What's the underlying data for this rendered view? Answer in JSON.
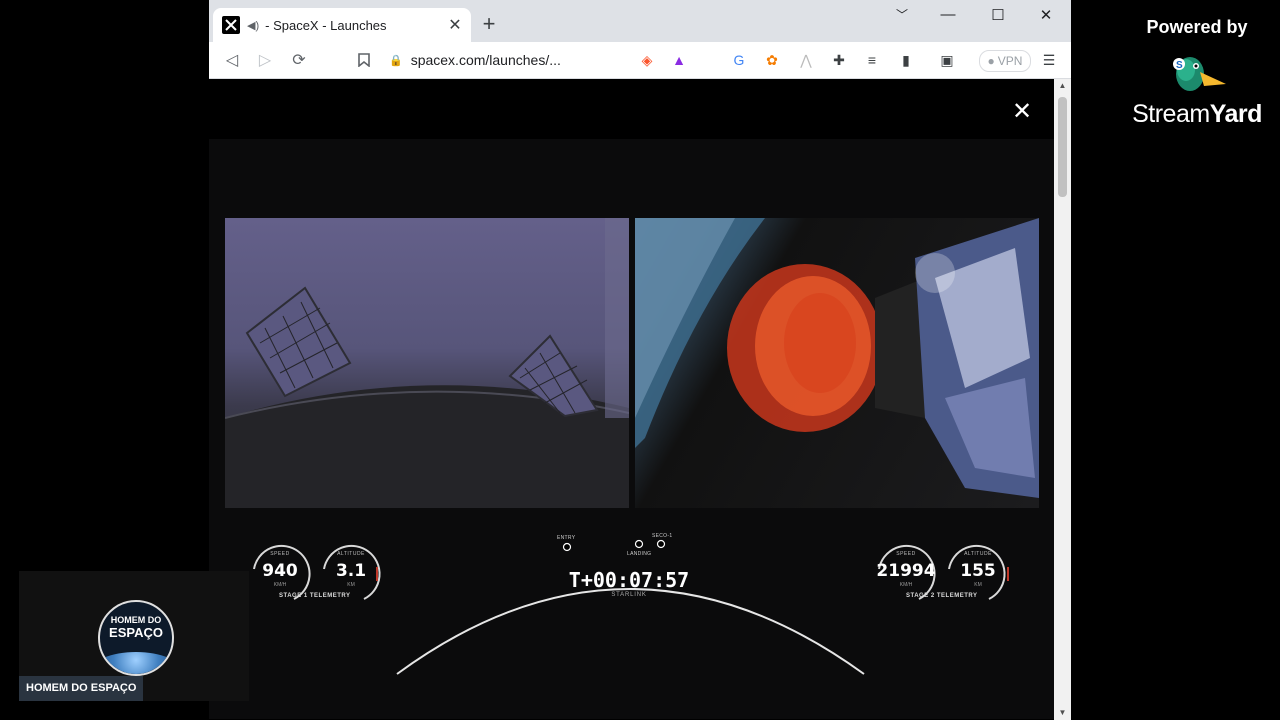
{
  "browser": {
    "tab_title": "- SpaceX - Launches",
    "url": "spacex.com/launches/...",
    "vpn_label": "VPN"
  },
  "telemetry": {
    "stage1": {
      "label": "STAGE 1 TELEMETRY",
      "speed": {
        "label": "SPEED",
        "value": "940",
        "unit": "KM/H"
      },
      "altitude": {
        "label": "ALTITUDE",
        "value": "3.1",
        "unit": "KM"
      }
    },
    "stage2": {
      "label": "STAGE 2 TELEMETRY",
      "speed": {
        "label": "SPEED",
        "value": "21994",
        "unit": "KM/H"
      },
      "altitude": {
        "label": "ALTITUDE",
        "value": "155",
        "unit": "KM"
      }
    },
    "clock": "T+00:07:57",
    "mission": "STARLINK",
    "events": {
      "entry": "ENTRY",
      "landing": "LANDING",
      "seco": "SECO-1"
    }
  },
  "overlay": {
    "powered_by": "Powered by",
    "brand_stream": "Stream",
    "brand_yard": "Yard"
  },
  "webcam": {
    "avatar_line1": "HOMEM DO",
    "avatar_line2": "ESPAÇO",
    "name": "HOMEM DO ESPAÇO"
  }
}
